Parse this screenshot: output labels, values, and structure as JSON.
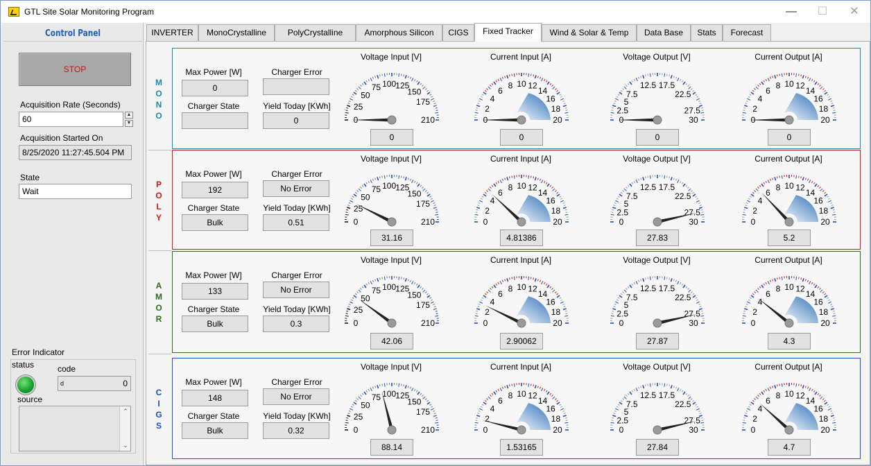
{
  "window": {
    "title": "GTL Site Solar Monitoring Program"
  },
  "control_panel": {
    "title": "Control Panel",
    "stop_label": "STOP",
    "acq_rate_label": "Acquisition Rate (Seconds)",
    "acq_rate_value": "60",
    "acq_started_label": "Acquisition Started On",
    "acq_started_value": "8/25/2020 11:27:45.504 PM",
    "state_label": "State",
    "state_value": "Wait",
    "error_indicator_label": "Error Indicator",
    "status_label": "status",
    "code_label": "code",
    "code_prefix": "d",
    "code_value": "0",
    "source_label": "source"
  },
  "tabs": [
    "INVERTER",
    "MonoCrystalline",
    "PolyCrystalline",
    "Amorphous Silicon",
    "CIGS",
    "Fixed Tracker",
    "Wind & Solar & Temp",
    "Data Base",
    "Stats",
    "Forecast"
  ],
  "active_tab": "Fixed Tracker",
  "labels": {
    "max_power": "Max Power [W]",
    "charger_error": "Charger Error",
    "charger_state": "Charger State",
    "yield_today": "Yield Today [KWh]"
  },
  "gauge_scales": {
    "voltage_input": {
      "min": 0,
      "max": 210,
      "ticks": [
        "0",
        "25",
        "50",
        "75",
        "100",
        "125",
        "150",
        "175",
        "210"
      ]
    },
    "current": {
      "min": 0,
      "max": 20,
      "ticks": [
        "0",
        "2",
        "4",
        "6",
        "8",
        "10",
        "12",
        "14",
        "16",
        "18",
        "20"
      ]
    },
    "voltage_output": {
      "min": 0,
      "max": 30,
      "ticks": [
        "0",
        "2.5",
        "5",
        "7.5",
        "12.5",
        "17.5",
        "22.5",
        "27.5",
        "30"
      ]
    }
  },
  "rows": [
    {
      "label": "MONO",
      "color": "#1a8aa8",
      "max_power": "0",
      "charger_error": "",
      "charger_state": "",
      "yield_today": "0",
      "gauges": [
        {
          "title": "Voltage Input [V]",
          "scale": "voltage_input",
          "value": 0,
          "display": "0"
        },
        {
          "title": "Current Input [A]",
          "scale": "current",
          "value": 0,
          "display": "0"
        },
        {
          "title": "Voltage Output [V]",
          "scale": "voltage_output",
          "value": 0,
          "display": "0"
        },
        {
          "title": "Current Output [A]",
          "scale": "current",
          "value": 0,
          "display": "0"
        }
      ]
    },
    {
      "label": "POLY",
      "color": "#d01818",
      "max_power": "192",
      "charger_error": "No Error",
      "charger_state": "Bulk",
      "yield_today": "0.51",
      "gauges": [
        {
          "title": "Voltage Input [V]",
          "scale": "voltage_input",
          "value": 31.16,
          "display": "31.16"
        },
        {
          "title": "Current Input [A]",
          "scale": "current",
          "value": 4.81386,
          "display": "4.81386"
        },
        {
          "title": "Voltage Output [V]",
          "scale": "voltage_output",
          "value": 27.83,
          "display": "27.83"
        },
        {
          "title": "Current Output [A]",
          "scale": "current",
          "value": 5.2,
          "display": "5.2"
        }
      ]
    },
    {
      "label": "AMOR",
      "color": "#2e6a1a",
      "max_power": "133",
      "charger_error": "No Error",
      "charger_state": "Bulk",
      "yield_today": "0.3",
      "gauges": [
        {
          "title": "Voltage Input [V]",
          "scale": "voltage_input",
          "value": 42.06,
          "display": "42.06"
        },
        {
          "title": "Current Input [A]",
          "scale": "current",
          "value": 2.90062,
          "display": "2.90062"
        },
        {
          "title": "Voltage Output [V]",
          "scale": "voltage_output",
          "value": 27.87,
          "display": "27.87"
        },
        {
          "title": "Current Output [A]",
          "scale": "current",
          "value": 4.3,
          "display": "4.3"
        }
      ]
    },
    {
      "label": "CIGS",
      "color": "#1c4fbf",
      "max_power": "148",
      "charger_error": "No Error",
      "charger_state": "Bulk",
      "yield_today": "0.32",
      "gauges": [
        {
          "title": "Voltage Input [V]",
          "scale": "voltage_input",
          "value": 88.14,
          "display": "88.14"
        },
        {
          "title": "Current Input [A]",
          "scale": "current",
          "value": 1.53165,
          "display": "1.53165"
        },
        {
          "title": "Voltage Output [V]",
          "scale": "voltage_output",
          "value": 27.84,
          "display": "27.84"
        },
        {
          "title": "Current Output [A]",
          "scale": "current",
          "value": 4.7,
          "display": "4.7"
        }
      ]
    }
  ]
}
